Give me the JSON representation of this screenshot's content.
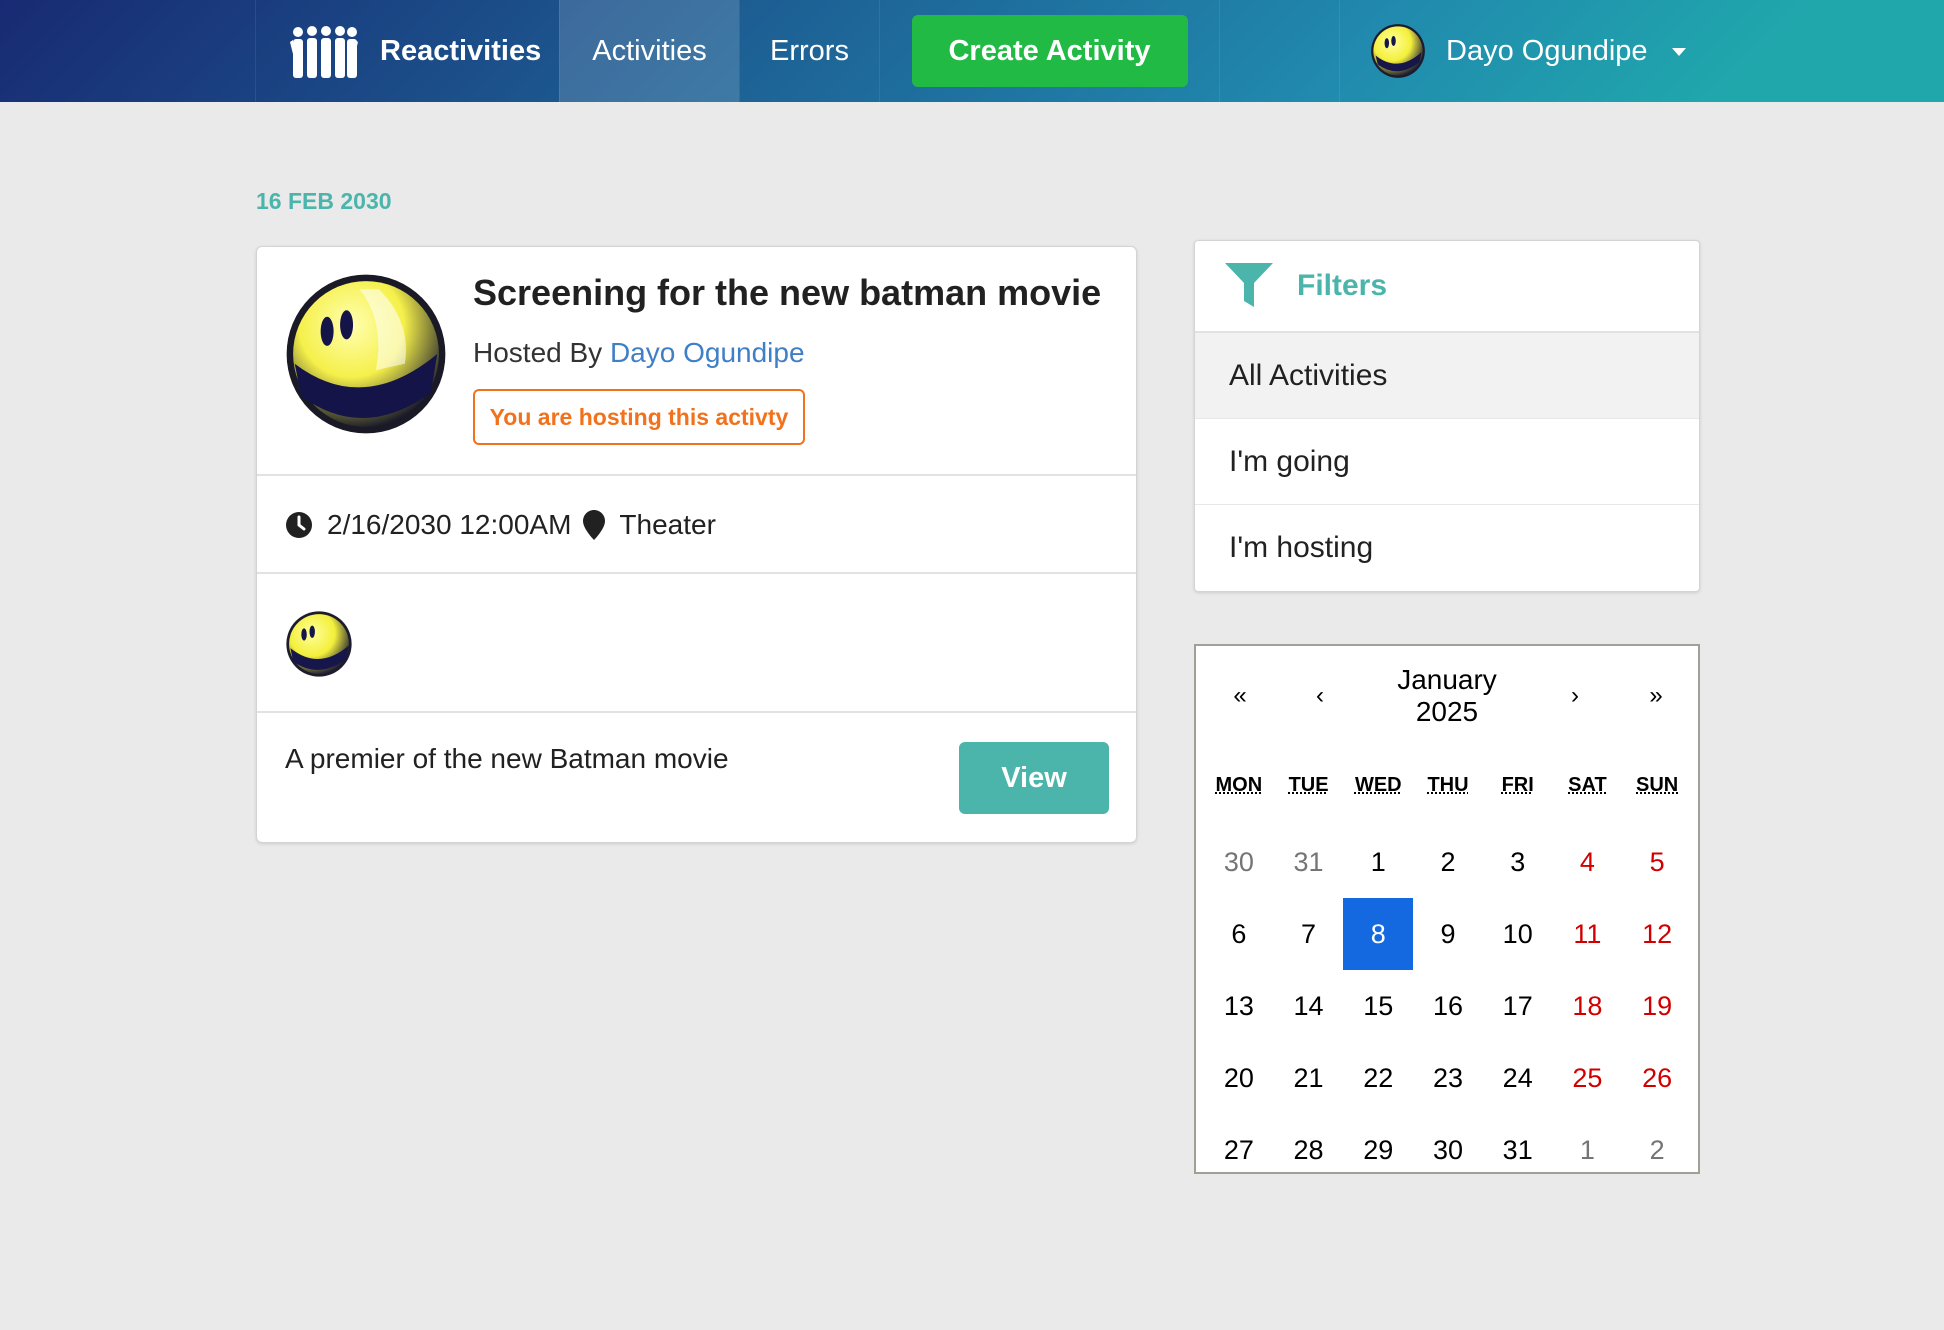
{
  "navbar": {
    "brand": "Reactivities",
    "activities": "Activities",
    "errors": "Errors",
    "create_activity": "Create Activity",
    "user_name": "Dayo Ogundipe",
    "logo_icon": "group-people-icon",
    "caret_icon": "caret-down-icon",
    "accent_green": "#21ba45"
  },
  "group": {
    "date_header": "16 FEB 2030"
  },
  "activity": {
    "title": "Screening for the new batman movie",
    "hosted_by_prefix": "Hosted By",
    "host_name": "Dayo Ogundipe",
    "hosting_label": "You are hosting this activty",
    "datetime": "2/16/2030 12:00AM",
    "venue": "Theater",
    "description": "A premier of the new Batman movie",
    "view_button": "View",
    "clock_icon": "clock-icon",
    "marker_icon": "map-marker-icon",
    "accent_teal": "#4bb5ab",
    "accent_orange": "#f2711c"
  },
  "filters": {
    "title": "Filters",
    "icon": "filter-icon",
    "items": [
      {
        "label": "All Activities",
        "active": true
      },
      {
        "label": "I'm going",
        "active": false
      },
      {
        "label": "I'm hosting",
        "active": false
      }
    ]
  },
  "calendar": {
    "prev2": "«",
    "prev": "‹",
    "month": "January",
    "year": "2025",
    "next": "›",
    "next2": "»",
    "weekdays": [
      "MON",
      "TUE",
      "WED",
      "THU",
      "FRI",
      "SAT",
      "SUN"
    ],
    "days": [
      {
        "d": "30",
        "t": "neighbor"
      },
      {
        "d": "31",
        "t": "neighbor"
      },
      {
        "d": "1",
        "t": ""
      },
      {
        "d": "2",
        "t": ""
      },
      {
        "d": "3",
        "t": ""
      },
      {
        "d": "4",
        "t": "weekend"
      },
      {
        "d": "5",
        "t": "weekend"
      },
      {
        "d": "6",
        "t": ""
      },
      {
        "d": "7",
        "t": ""
      },
      {
        "d": "8",
        "t": "active"
      },
      {
        "d": "9",
        "t": ""
      },
      {
        "d": "10",
        "t": ""
      },
      {
        "d": "11",
        "t": "weekend"
      },
      {
        "d": "12",
        "t": "weekend"
      },
      {
        "d": "13",
        "t": ""
      },
      {
        "d": "14",
        "t": ""
      },
      {
        "d": "15",
        "t": ""
      },
      {
        "d": "16",
        "t": ""
      },
      {
        "d": "17",
        "t": ""
      },
      {
        "d": "18",
        "t": "weekend"
      },
      {
        "d": "19",
        "t": "weekend"
      },
      {
        "d": "20",
        "t": ""
      },
      {
        "d": "21",
        "t": ""
      },
      {
        "d": "22",
        "t": ""
      },
      {
        "d": "23",
        "t": ""
      },
      {
        "d": "24",
        "t": ""
      },
      {
        "d": "25",
        "t": "weekend"
      },
      {
        "d": "26",
        "t": "weekend"
      },
      {
        "d": "27",
        "t": ""
      },
      {
        "d": "28",
        "t": ""
      },
      {
        "d": "29",
        "t": ""
      },
      {
        "d": "30",
        "t": ""
      },
      {
        "d": "31",
        "t": ""
      },
      {
        "d": "1",
        "t": "neighbor"
      },
      {
        "d": "2",
        "t": "neighbor"
      }
    ],
    "selected_color": "#1569e0",
    "weekend_color": "#d10000"
  }
}
